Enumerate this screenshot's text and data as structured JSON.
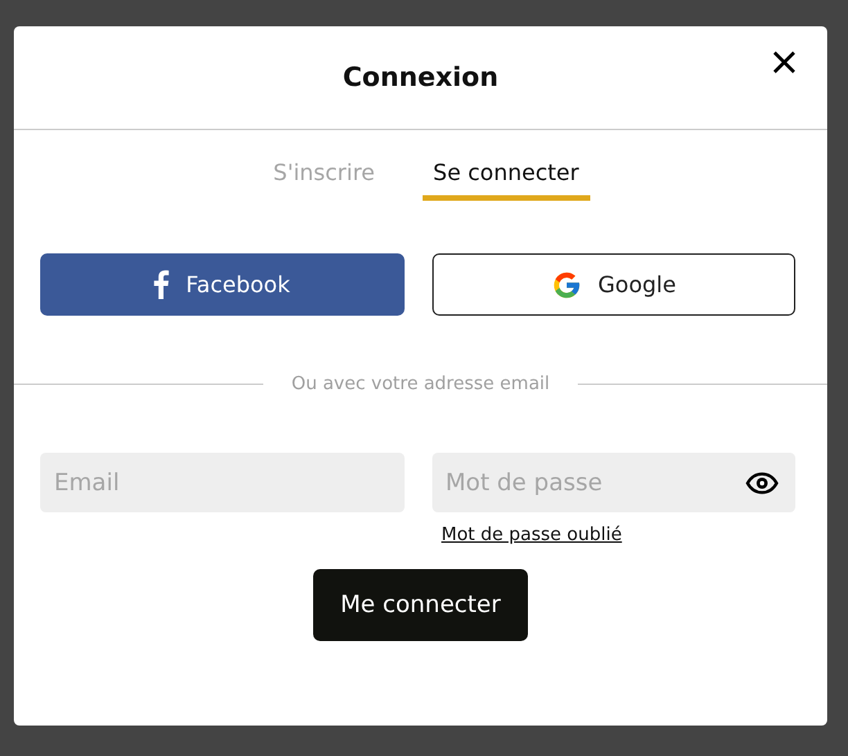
{
  "dialog": {
    "title": "Connexion",
    "tabs": [
      {
        "label": "S'inscrire",
        "selected": false
      },
      {
        "label": "Se connecter",
        "selected": true
      }
    ],
    "social": [
      {
        "kind": "facebook",
        "label": "Facebook"
      },
      {
        "kind": "google",
        "label": "Google"
      }
    ],
    "divider": "Ou avec votre adresse email",
    "fields": [
      {
        "kind": "email",
        "placeholder": "Email"
      },
      {
        "kind": "password",
        "placeholder": "Mot de passe"
      }
    ],
    "forgot_link": "Mot de passe oublié",
    "submit": "Me connecter"
  }
}
